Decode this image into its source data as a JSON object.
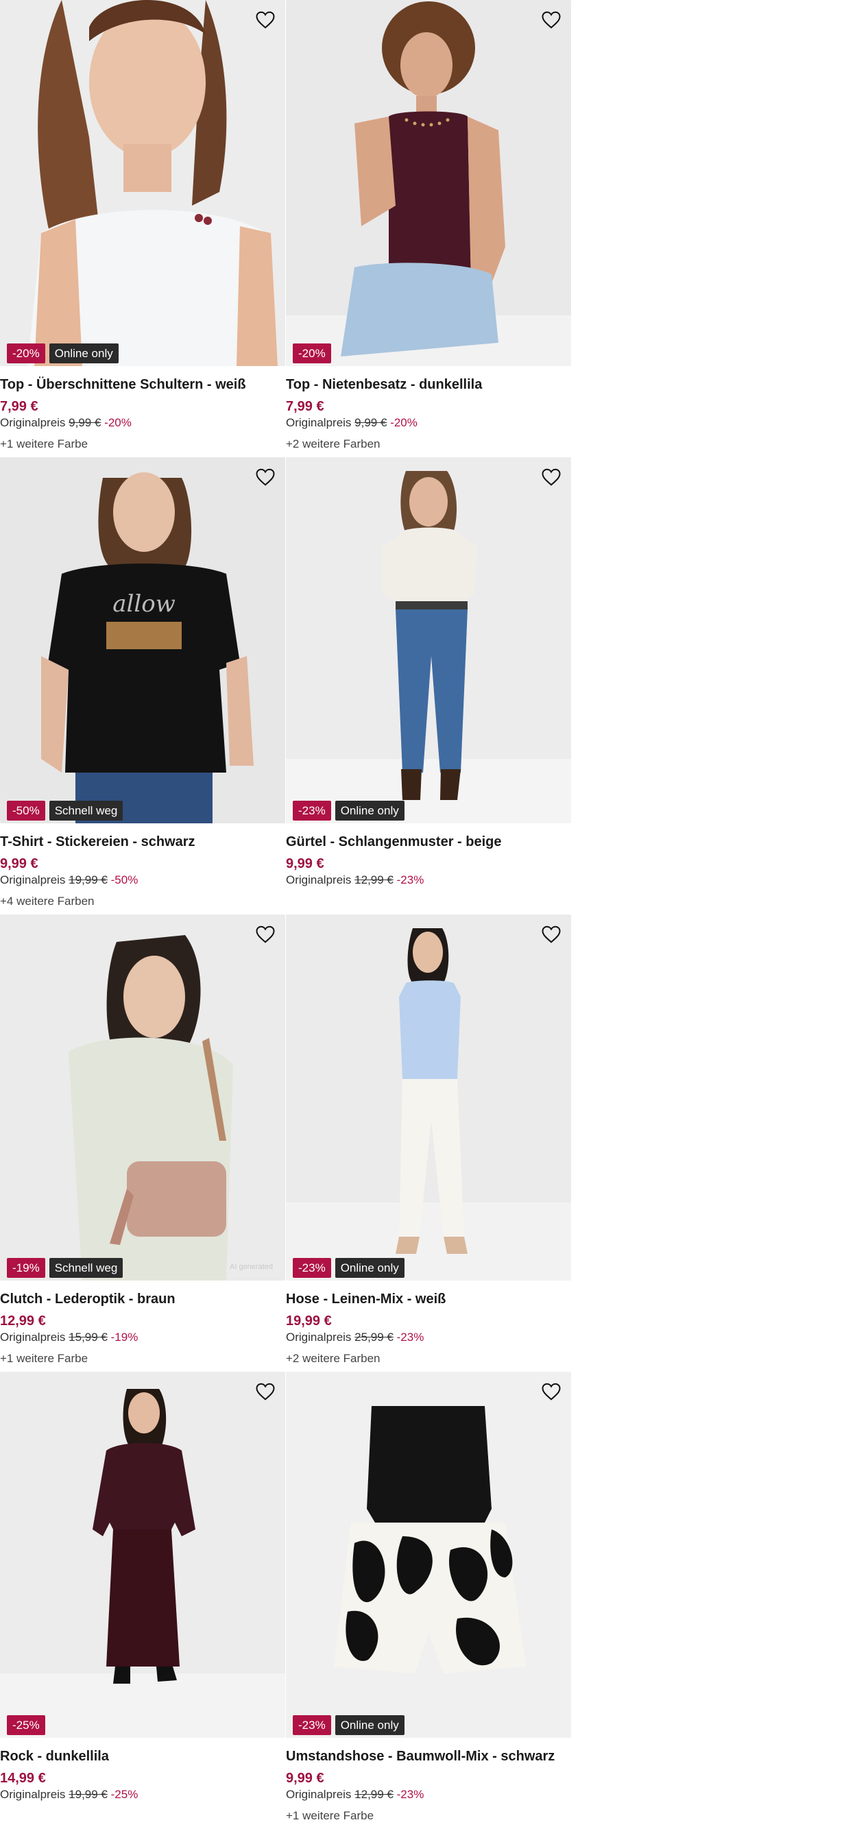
{
  "products": [
    {
      "title": "Top - Überschnittene Schultern - weiß",
      "price": "7,99 €",
      "orig_label": "Originalpreis",
      "orig_price": "9,99 €",
      "orig_discount": "-20%",
      "badge_discount": "-20%",
      "badge_label": "Online only",
      "colors": "+1 weitere Farbe",
      "image": "model-white-tank-top"
    },
    {
      "title": "Top - Nietenbesatz - dunkellila",
      "price": "7,99 €",
      "orig_label": "Originalpreis",
      "orig_price": "9,99 €",
      "orig_discount": "-20%",
      "badge_discount": "-20%",
      "badge_label": "",
      "colors": "+2 weitere Farben",
      "image": "model-purple-tank-top"
    },
    {
      "title": "T-Shirt - Stickereien - schwarz",
      "price": "9,99 €",
      "orig_label": "Originalpreis",
      "orig_price": "19,99 €",
      "orig_discount": "-50%",
      "badge_discount": "-50%",
      "badge_label": "Schnell weg",
      "colors": "+4 weitere Farben",
      "image": "model-black-tshirt"
    },
    {
      "title": "Gürtel - Schlangenmuster - beige",
      "price": "9,99 €",
      "orig_label": "Originalpreis",
      "orig_price": "12,99 €",
      "orig_discount": "-23%",
      "badge_discount": "-23%",
      "badge_label": "Online only",
      "colors": "",
      "image": "model-jeans-belt"
    },
    {
      "title": "Clutch - Lederoptik - braun",
      "price": "12,99 €",
      "orig_label": "Originalpreis",
      "orig_price": "15,99 €",
      "orig_discount": "-19%",
      "badge_discount": "-19%",
      "badge_label": "Schnell weg",
      "colors": "+1 weitere Farbe",
      "image": "model-clutch-bag",
      "footnote": "AI generated"
    },
    {
      "title": "Hose - Leinen-Mix - weiß",
      "price": "19,99 €",
      "orig_label": "Originalpreis",
      "orig_price": "25,99 €",
      "orig_discount": "-23%",
      "badge_discount": "-23%",
      "badge_label": "Online only",
      "colors": "+2 weitere Farben",
      "image": "model-white-trousers"
    },
    {
      "title": "Rock - dunkellila",
      "price": "14,99 €",
      "orig_label": "Originalpreis",
      "orig_price": "19,99 €",
      "orig_discount": "-25%",
      "badge_discount": "-25%",
      "badge_label": "",
      "colors": "",
      "image": "model-purple-skirt"
    },
    {
      "title": "Umstandshose - Baumwoll-Mix - schwarz",
      "price": "9,99 €",
      "orig_label": "Originalpreis",
      "orig_price": "12,99 €",
      "orig_discount": "-23%",
      "badge_discount": "-23%",
      "badge_label": "Online only",
      "colors": "+1 weitere Farbe",
      "image": "maternity-shorts-black-white"
    }
  ],
  "colors": {
    "discount": "#b01245",
    "label_bg": "#2b2b2b",
    "price": "#9c1240"
  },
  "icons": {
    "wishlist": "heart-outline-icon"
  }
}
